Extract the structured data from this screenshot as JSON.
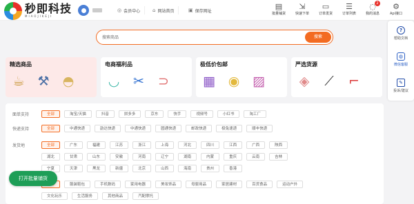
{
  "header": {
    "logo_text": "秒即科技",
    "logo_sub": "MIAOJIKEJI",
    "nav": [
      {
        "icon": "user-circle-icon",
        "label": "会员中心"
      },
      {
        "icon": "home-icon",
        "label": "网站首页"
      },
      {
        "icon": "bookmark-icon",
        "label": "保存网址"
      }
    ],
    "tools": [
      {
        "icon": "cart-icon",
        "label": "批量铺货"
      },
      {
        "icon": "truck-icon",
        "label": "快速下单"
      },
      {
        "icon": "order-icon",
        "label": "订单发货"
      },
      {
        "icon": "list-icon",
        "label": "订单列表"
      },
      {
        "icon": "message-icon",
        "label": "我的消息",
        "badge": "2"
      },
      {
        "icon": "api-icon",
        "label": "Api接口"
      }
    ]
  },
  "search": {
    "placeholder": "搜索商品",
    "button": "搜索"
  },
  "side": {
    "items": [
      {
        "icon": "help-icon",
        "label": "帮助文档"
      },
      {
        "icon": "wechat-icon",
        "label": "微信客服"
      },
      {
        "icon": "report-icon",
        "label": "投诉/建议"
      }
    ]
  },
  "categories": [
    {
      "title": "精选商品",
      "icons": [
        "mug-icon",
        "tools-icon",
        "bag-icon"
      ],
      "active": true
    },
    {
      "title": "电商福利品",
      "icons": [
        "basin-icon",
        "scissors-icon",
        "slippers-icon"
      ]
    },
    {
      "title": "极低价包邮",
      "icons": [
        "notebooks-icon",
        "tape-icon",
        "bag-icon"
      ]
    },
    {
      "title": "严选货源",
      "icons": [
        "handbag-icon",
        "brush-icon",
        "heels-icon"
      ]
    }
  ],
  "filters": {
    "platform": {
      "label": "面单支持",
      "options": [
        "全部",
        "淘宝/天猫",
        "抖音",
        "拼多多",
        "京东",
        "快手",
        "视频号",
        "小红书",
        "淘工厂"
      ]
    },
    "express": {
      "label": "快递支持",
      "options": [
        "全部",
        "中通快递",
        "韵达快递",
        "中通快递",
        "圆通快递",
        "邮政快递",
        "极兔速递",
        "顺丰快递"
      ]
    },
    "origin": {
      "label": "发货地",
      "row1": [
        "全部",
        "广东",
        "福建",
        "江苏",
        "浙江",
        "上海",
        "河北",
        "四川",
        "江西",
        "广西",
        "陕西"
      ],
      "row2": [
        "湖北",
        "甘肃",
        "山东",
        "安徽",
        "河南",
        "辽宁",
        "湖南",
        "内蒙",
        "重庆",
        "云南",
        "吉林"
      ],
      "row3": [
        "宁夏",
        "天津",
        "黑龙",
        "新疆",
        "北京",
        "山西",
        "海南",
        "贵州",
        "香港"
      ]
    },
    "category": {
      "row1": [
        "全部",
        "服装鞋包",
        "手机数码",
        "家用电器",
        "美妆饰品",
        "母婴用品",
        "家居建材",
        "百货食品",
        "运动户外"
      ],
      "row2": [
        "文化玩乐",
        "生活服务",
        "其他商品",
        "汽配摩托"
      ]
    }
  },
  "batch_button": "打开批量铺货"
}
